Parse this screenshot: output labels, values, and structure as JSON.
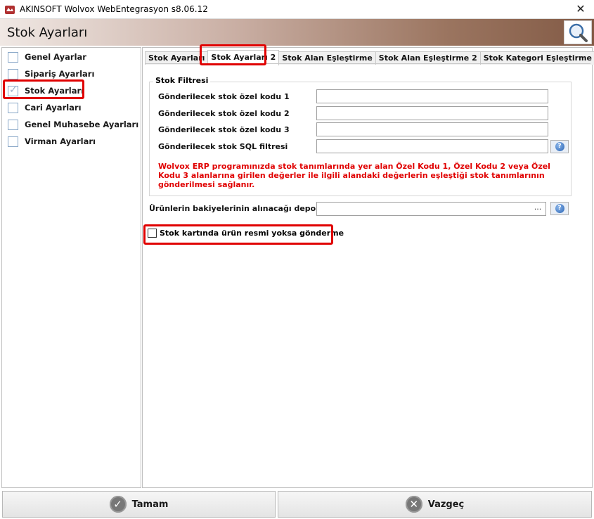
{
  "window": {
    "title": "AKINSOFT Wolvox WebEntegrasyon s8.06.12",
    "close_glyph": "✕"
  },
  "header": {
    "title": "Stok Ayarları",
    "search_icon": "magnifier-icon"
  },
  "sidebar": {
    "items": [
      {
        "label": "Genel Ayarlar",
        "checked": false
      },
      {
        "label": "Sipariş Ayarları",
        "checked": false
      },
      {
        "label": "Stok Ayarları",
        "checked": true
      },
      {
        "label": "Cari Ayarları",
        "checked": false
      },
      {
        "label": "Genel Muhasebe Ayarları",
        "checked": false
      },
      {
        "label": "Virman Ayarları",
        "checked": false
      }
    ]
  },
  "tabs": [
    {
      "label": "Stok Ayarları"
    },
    {
      "label": "Stok Ayarları 2"
    },
    {
      "label": "Stok Alan Eşleştirme"
    },
    {
      "label": "Stok Alan Eşleştirme 2"
    },
    {
      "label": "Stok Kategori Eşleştirme"
    }
  ],
  "filter_group": {
    "legend": "Stok Filtresi",
    "fields": [
      {
        "label": "Gönderilecek stok özel kodu 1",
        "value": ""
      },
      {
        "label": "Gönderilecek stok özel kodu 2",
        "value": ""
      },
      {
        "label": "Gönderilecek stok özel kodu 3",
        "value": ""
      },
      {
        "label": "Gönderilecek stok SQL filtresi",
        "value": ""
      }
    ],
    "help_glyph": "?",
    "warning": "Wolvox ERP programınızda stok tanımlarında yer alan Özel Kodu 1, Özel Kodu 2 veya Özel Kodu 3 alanlarına girilen değerler ile ilgili alandaki değerlerin eşleştiği stok tanımlarının gönderilmesi sağlanır."
  },
  "depot": {
    "label": "Ürünlerin bakiyelerinin alınacağı depolar",
    "value": "",
    "ellipsis": "...",
    "help_glyph": "?"
  },
  "no_image_option": {
    "label": "Stok kartında ürün resmi yoksa gönderme",
    "checked": false
  },
  "footer": {
    "ok_label": "Tamam",
    "ok_glyph": "✓",
    "cancel_label": "Vazgeç",
    "cancel_glyph": "✕"
  },
  "colors": {
    "highlight": "#e00000",
    "warning_text": "#e00000",
    "header_gradient_end": "#825a45"
  }
}
